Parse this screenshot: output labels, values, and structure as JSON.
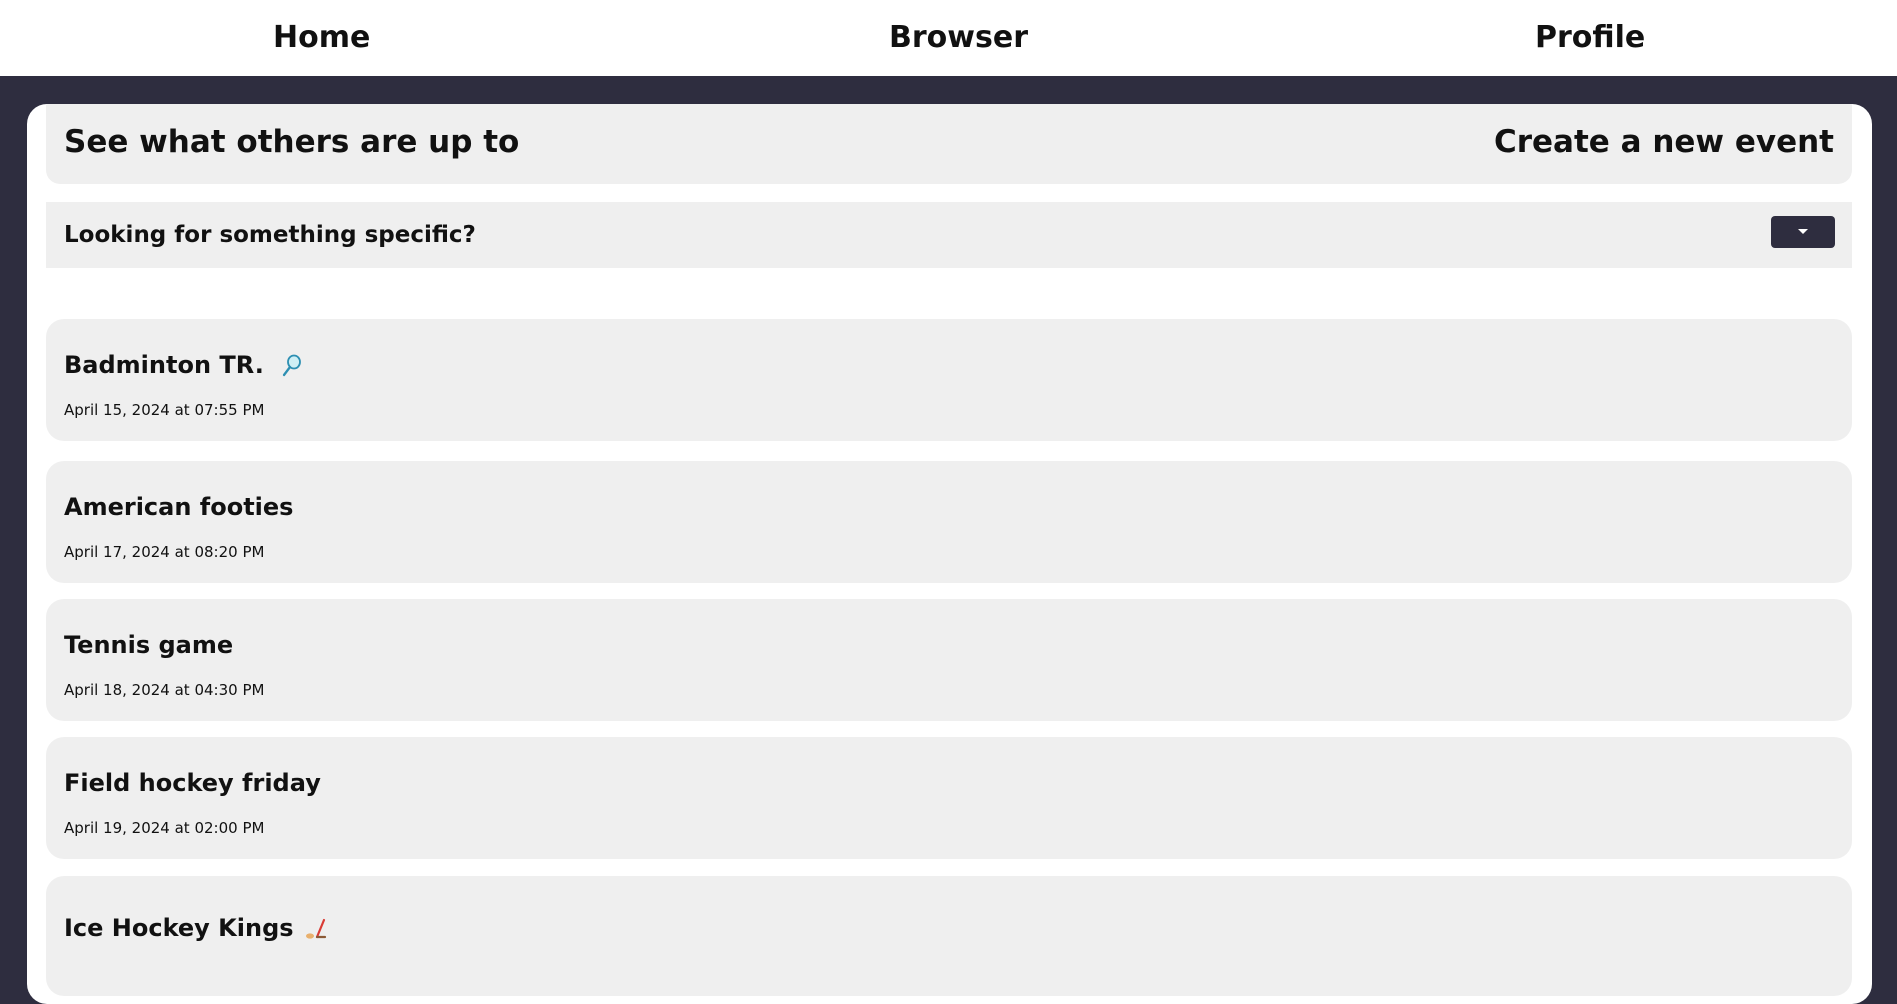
{
  "nav": {
    "home": "Home",
    "browser": "Browser",
    "profile": "Profile"
  },
  "header": {
    "title": "See what others are up to",
    "create": "Create a new event"
  },
  "filter": {
    "title": "Looking for something specific?"
  },
  "events": [
    {
      "title": "Badminton TR.",
      "date": "April 15, 2024 at 07:55 PM",
      "icon": "badminton-racket-icon"
    },
    {
      "title": "American footies",
      "date": "April 17, 2024 at 08:20 PM"
    },
    {
      "title": "Tennis game",
      "date": "April 18, 2024 at 04:30 PM"
    },
    {
      "title": "Field hockey friday",
      "date": "April 19, 2024 at 02:00 PM"
    },
    {
      "title": "Ice Hockey Kings",
      "date": "",
      "icon": "ice-hockey-icon"
    }
  ],
  "colors": {
    "background": "#2e2d3f",
    "card": "#efefef",
    "text": "#111111"
  }
}
